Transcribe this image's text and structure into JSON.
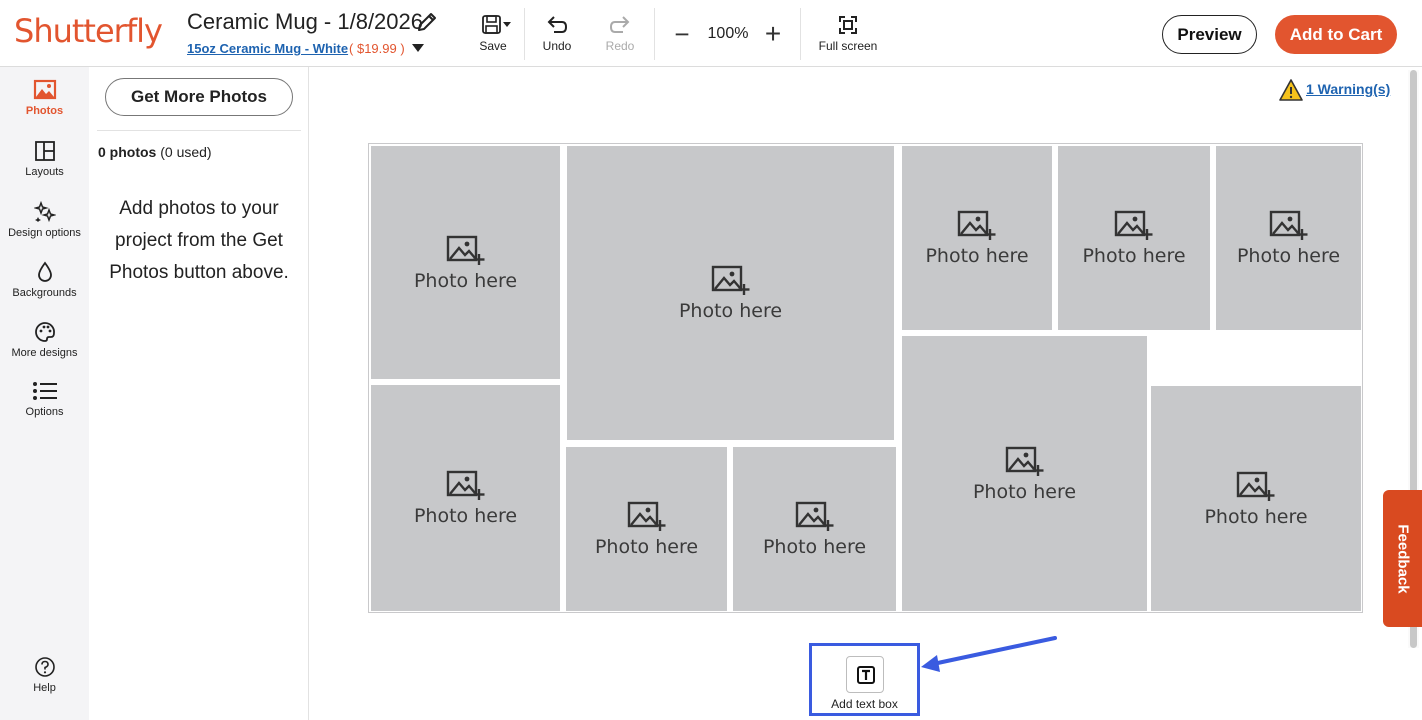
{
  "header": {
    "logo": "Shutterfly",
    "project_title": "Ceramic Mug - 1/8/2026",
    "product_name": "15oz Ceramic Mug - White",
    "price": "$19.99",
    "toolbar": {
      "save_label": "Save",
      "undo_label": "Undo",
      "redo_label": "Redo",
      "zoom_value": "100%",
      "fullscreen_label": "Full screen"
    },
    "preview_label": "Preview",
    "add_to_cart_label": "Add to Cart"
  },
  "rail": {
    "items": [
      {
        "label": "Photos",
        "icon": "photos-icon",
        "active": true
      },
      {
        "label": "Layouts",
        "icon": "layouts-icon"
      },
      {
        "label": "Design options",
        "icon": "design-options-icon"
      },
      {
        "label": "Backgrounds",
        "icon": "backgrounds-icon"
      },
      {
        "label": "More designs",
        "icon": "palette-icon"
      },
      {
        "label": "Options",
        "icon": "list-icon"
      }
    ],
    "help_label": "Help"
  },
  "panel": {
    "get_more_photos_label": "Get More Photos",
    "photo_count": "0 photos",
    "photo_used": "(0 used)",
    "hint": "Add photos to your project from the Get Photos button above."
  },
  "canvas": {
    "warning_text": "1 Warning(s)",
    "slot_label": "Photo here",
    "add_text_box_label": "Add text box"
  },
  "feedback_label": "Feedback",
  "colors": {
    "brand": "#e2552f",
    "link": "#1e63b0",
    "slot": "#c7c8ca",
    "highlight": "#3a5be0"
  }
}
